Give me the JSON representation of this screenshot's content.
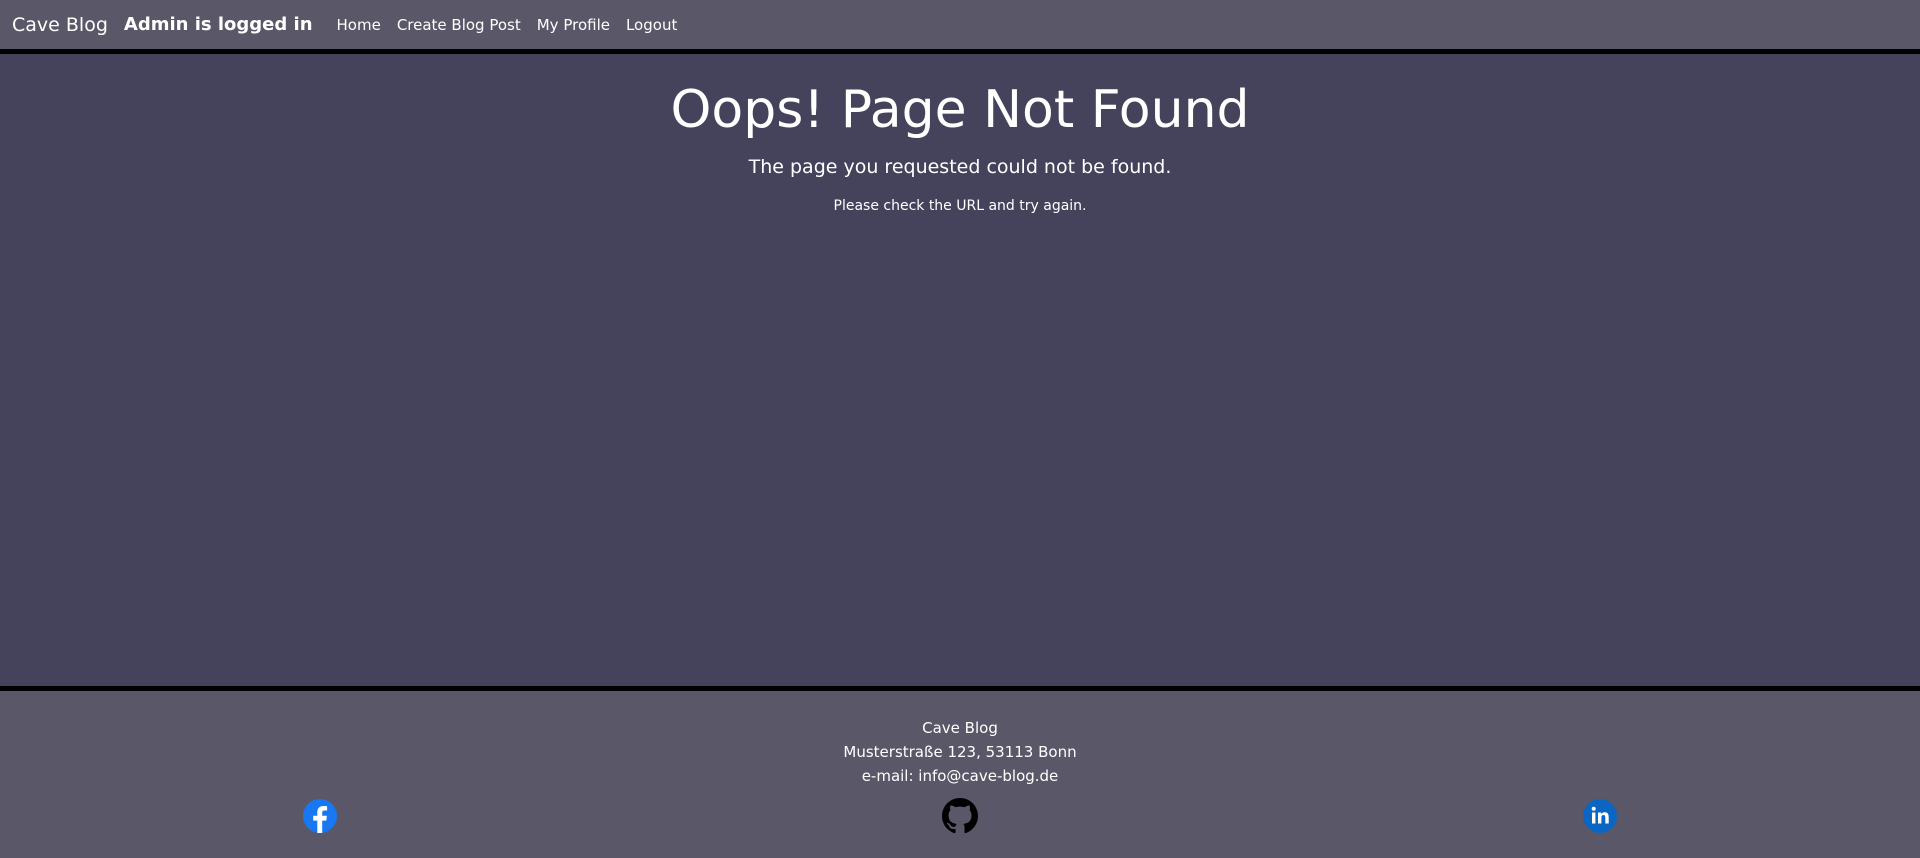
{
  "navbar": {
    "brand": "Cave Blog",
    "status": "Admin is logged in",
    "links": [
      {
        "label": "Home"
      },
      {
        "label": "Create Blog Post"
      },
      {
        "label": "My Profile"
      },
      {
        "label": "Logout"
      }
    ]
  },
  "main": {
    "title": "Oops! Page Not Found",
    "message": "The page you requested could not be found.",
    "hint": "Please check the URL and try again."
  },
  "footer": {
    "name": "Cave Blog",
    "address": "Musterstraße 123, 53113 Bonn",
    "email": "e-mail: info@cave-blog.de",
    "social": [
      {
        "icon": "facebook-icon",
        "color": "#1877f2"
      },
      {
        "icon": "github-icon",
        "color": "#000000"
      },
      {
        "icon": "linkedin-icon",
        "color": "#0a66c2"
      }
    ]
  },
  "colors": {
    "header_bg": "#5a5868",
    "main_bg": "#45425c",
    "divider": "#000000"
  }
}
